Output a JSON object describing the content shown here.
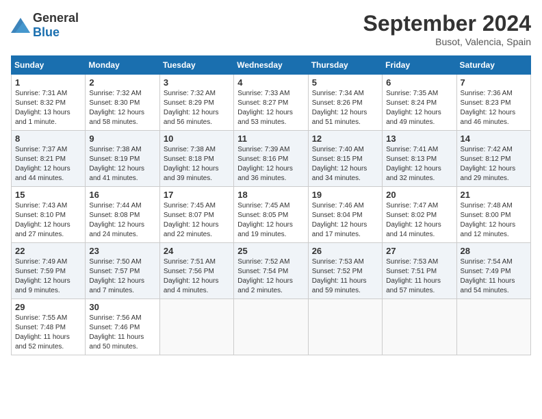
{
  "logo": {
    "general": "General",
    "blue": "Blue"
  },
  "header": {
    "month": "September 2024",
    "location": "Busot, Valencia, Spain"
  },
  "weekdays": [
    "Sunday",
    "Monday",
    "Tuesday",
    "Wednesday",
    "Thursday",
    "Friday",
    "Saturday"
  ],
  "weeks": [
    [
      {
        "day": "1",
        "sunrise": "Sunrise: 7:31 AM",
        "sunset": "Sunset: 8:32 PM",
        "daylight": "Daylight: 13 hours and 1 minute."
      },
      {
        "day": "2",
        "sunrise": "Sunrise: 7:32 AM",
        "sunset": "Sunset: 8:30 PM",
        "daylight": "Daylight: 12 hours and 58 minutes."
      },
      {
        "day": "3",
        "sunrise": "Sunrise: 7:32 AM",
        "sunset": "Sunset: 8:29 PM",
        "daylight": "Daylight: 12 hours and 56 minutes."
      },
      {
        "day": "4",
        "sunrise": "Sunrise: 7:33 AM",
        "sunset": "Sunset: 8:27 PM",
        "daylight": "Daylight: 12 hours and 53 minutes."
      },
      {
        "day": "5",
        "sunrise": "Sunrise: 7:34 AM",
        "sunset": "Sunset: 8:26 PM",
        "daylight": "Daylight: 12 hours and 51 minutes."
      },
      {
        "day": "6",
        "sunrise": "Sunrise: 7:35 AM",
        "sunset": "Sunset: 8:24 PM",
        "daylight": "Daylight: 12 hours and 49 minutes."
      },
      {
        "day": "7",
        "sunrise": "Sunrise: 7:36 AM",
        "sunset": "Sunset: 8:23 PM",
        "daylight": "Daylight: 12 hours and 46 minutes."
      }
    ],
    [
      {
        "day": "8",
        "sunrise": "Sunrise: 7:37 AM",
        "sunset": "Sunset: 8:21 PM",
        "daylight": "Daylight: 12 hours and 44 minutes."
      },
      {
        "day": "9",
        "sunrise": "Sunrise: 7:38 AM",
        "sunset": "Sunset: 8:19 PM",
        "daylight": "Daylight: 12 hours and 41 minutes."
      },
      {
        "day": "10",
        "sunrise": "Sunrise: 7:38 AM",
        "sunset": "Sunset: 8:18 PM",
        "daylight": "Daylight: 12 hours and 39 minutes."
      },
      {
        "day": "11",
        "sunrise": "Sunrise: 7:39 AM",
        "sunset": "Sunset: 8:16 PM",
        "daylight": "Daylight: 12 hours and 36 minutes."
      },
      {
        "day": "12",
        "sunrise": "Sunrise: 7:40 AM",
        "sunset": "Sunset: 8:15 PM",
        "daylight": "Daylight: 12 hours and 34 minutes."
      },
      {
        "day": "13",
        "sunrise": "Sunrise: 7:41 AM",
        "sunset": "Sunset: 8:13 PM",
        "daylight": "Daylight: 12 hours and 32 minutes."
      },
      {
        "day": "14",
        "sunrise": "Sunrise: 7:42 AM",
        "sunset": "Sunset: 8:12 PM",
        "daylight": "Daylight: 12 hours and 29 minutes."
      }
    ],
    [
      {
        "day": "15",
        "sunrise": "Sunrise: 7:43 AM",
        "sunset": "Sunset: 8:10 PM",
        "daylight": "Daylight: 12 hours and 27 minutes."
      },
      {
        "day": "16",
        "sunrise": "Sunrise: 7:44 AM",
        "sunset": "Sunset: 8:08 PM",
        "daylight": "Daylight: 12 hours and 24 minutes."
      },
      {
        "day": "17",
        "sunrise": "Sunrise: 7:45 AM",
        "sunset": "Sunset: 8:07 PM",
        "daylight": "Daylight: 12 hours and 22 minutes."
      },
      {
        "day": "18",
        "sunrise": "Sunrise: 7:45 AM",
        "sunset": "Sunset: 8:05 PM",
        "daylight": "Daylight: 12 hours and 19 minutes."
      },
      {
        "day": "19",
        "sunrise": "Sunrise: 7:46 AM",
        "sunset": "Sunset: 8:04 PM",
        "daylight": "Daylight: 12 hours and 17 minutes."
      },
      {
        "day": "20",
        "sunrise": "Sunrise: 7:47 AM",
        "sunset": "Sunset: 8:02 PM",
        "daylight": "Daylight: 12 hours and 14 minutes."
      },
      {
        "day": "21",
        "sunrise": "Sunrise: 7:48 AM",
        "sunset": "Sunset: 8:00 PM",
        "daylight": "Daylight: 12 hours and 12 minutes."
      }
    ],
    [
      {
        "day": "22",
        "sunrise": "Sunrise: 7:49 AM",
        "sunset": "Sunset: 7:59 PM",
        "daylight": "Daylight: 12 hours and 9 minutes."
      },
      {
        "day": "23",
        "sunrise": "Sunrise: 7:50 AM",
        "sunset": "Sunset: 7:57 PM",
        "daylight": "Daylight: 12 hours and 7 minutes."
      },
      {
        "day": "24",
        "sunrise": "Sunrise: 7:51 AM",
        "sunset": "Sunset: 7:56 PM",
        "daylight": "Daylight: 12 hours and 4 minutes."
      },
      {
        "day": "25",
        "sunrise": "Sunrise: 7:52 AM",
        "sunset": "Sunset: 7:54 PM",
        "daylight": "Daylight: 12 hours and 2 minutes."
      },
      {
        "day": "26",
        "sunrise": "Sunrise: 7:53 AM",
        "sunset": "Sunset: 7:52 PM",
        "daylight": "Daylight: 11 hours and 59 minutes."
      },
      {
        "day": "27",
        "sunrise": "Sunrise: 7:53 AM",
        "sunset": "Sunset: 7:51 PM",
        "daylight": "Daylight: 11 hours and 57 minutes."
      },
      {
        "day": "28",
        "sunrise": "Sunrise: 7:54 AM",
        "sunset": "Sunset: 7:49 PM",
        "daylight": "Daylight: 11 hours and 54 minutes."
      }
    ],
    [
      {
        "day": "29",
        "sunrise": "Sunrise: 7:55 AM",
        "sunset": "Sunset: 7:48 PM",
        "daylight": "Daylight: 11 hours and 52 minutes."
      },
      {
        "day": "30",
        "sunrise": "Sunrise: 7:56 AM",
        "sunset": "Sunset: 7:46 PM",
        "daylight": "Daylight: 11 hours and 50 minutes."
      },
      null,
      null,
      null,
      null,
      null
    ]
  ]
}
